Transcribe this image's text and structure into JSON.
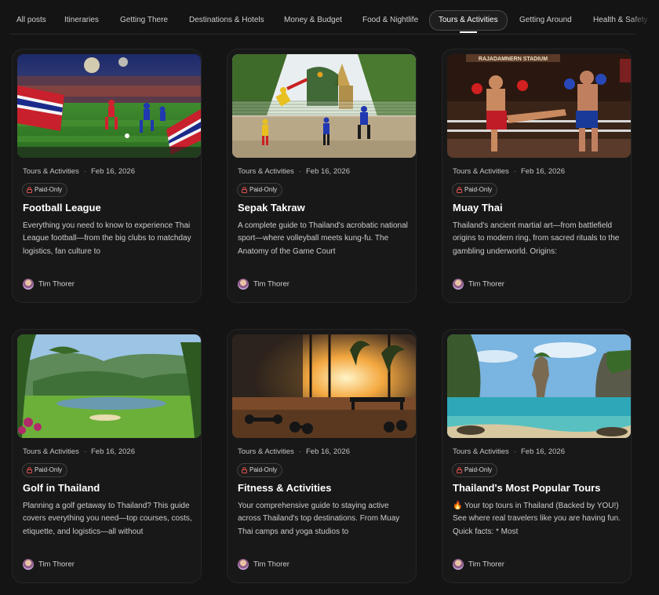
{
  "nav": {
    "tabs": [
      {
        "label": "All posts",
        "active": false
      },
      {
        "label": "Itineraries",
        "active": false
      },
      {
        "label": "Getting There",
        "active": false
      },
      {
        "label": "Destinations & Hotels",
        "active": false
      },
      {
        "label": "Money & Budget",
        "active": false
      },
      {
        "label": "Food & Nightlife",
        "active": false
      },
      {
        "label": "Tours & Activities",
        "active": true
      },
      {
        "label": "Getting Around",
        "active": false
      },
      {
        "label": "Health & Safety",
        "active": false
      }
    ]
  },
  "posts": [
    {
      "image": "football-stadium-photo",
      "category": "Tours & Activities",
      "separator": "·",
      "date": "Feb 16, 2026",
      "badge": "Paid-Only",
      "title": "Football League",
      "excerpt": "Everything you need to know to experience Thai League football—from the big clubs to matchday logistics, fan culture to",
      "author": "Tim Thorer"
    },
    {
      "image": "sepak-takraw-photo",
      "category": "Tours & Activities",
      "separator": "·",
      "date": "Feb 16, 2026",
      "badge": "Paid-Only",
      "title": "Sepak Takraw",
      "excerpt": "A complete guide to Thailand's acrobatic national sport—where volleyball meets kung-fu. The Anatomy of the Game Court",
      "author": "Tim Thorer"
    },
    {
      "image": "muay-thai-stadium-photo",
      "image_sign": "RAJADAMNERN STADIUM",
      "category": "Tours & Activities",
      "separator": "·",
      "date": "Feb 16, 2026",
      "badge": "Paid-Only",
      "title": "Muay Thai",
      "excerpt": "Thailand's ancient martial art—from battlefield origins to modern ring, from sacred rituals to the gambling underworld. Origins:",
      "author": "Tim Thorer"
    },
    {
      "image": "golf-course-photo",
      "category": "Tours & Activities",
      "separator": "·",
      "date": "Feb 16, 2026",
      "badge": "Paid-Only",
      "title": "Golf in Thailand",
      "excerpt": "Planning a golf getaway to Thailand? This guide covers everything you need—top courses, costs, etiquette, and logistics—all without",
      "author": "Tim Thorer"
    },
    {
      "image": "gym-sunset-photo",
      "category": "Tours & Activities",
      "separator": "·",
      "date": "Feb 16, 2026",
      "badge": "Paid-Only",
      "title": "Fitness & Activities",
      "excerpt": "Your comprehensive guide to staying active across Thailand's top destinations. From Muay Thai camps and yoga studios to",
      "author": "Tim Thorer"
    },
    {
      "image": "limestone-island-beach-photo",
      "category": "Tours & Activities",
      "separator": "·",
      "date": "Feb 16, 2026",
      "badge": "Paid-Only",
      "title": "Thailand's Most Popular Tours",
      "excerpt": "🔥 Your top tours in Thailand (Backed by YOU!) See where real travelers like you are having fun. Quick facts: * Most",
      "author": "Tim Thorer"
    }
  ]
}
